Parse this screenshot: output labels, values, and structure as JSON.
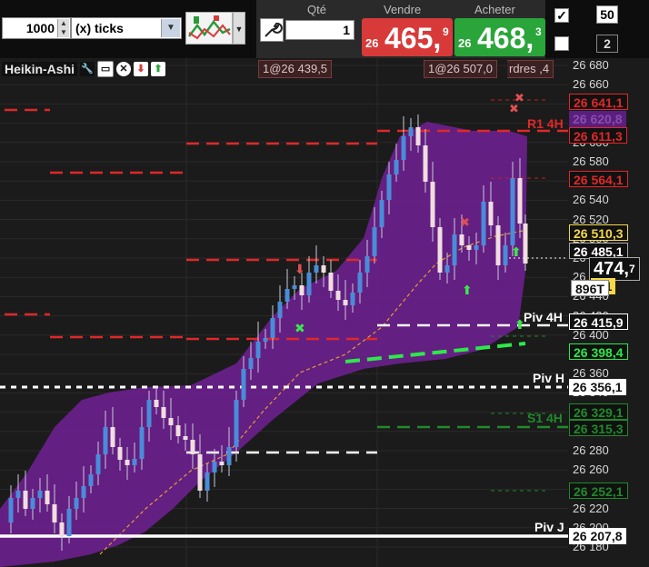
{
  "toolbar": {
    "tick_count": "1000",
    "tick_unit": "(x) ticks",
    "strategy_icon": "strategy-chart-icon"
  },
  "order": {
    "qty_label": "Qté",
    "qty_value": "1",
    "sell_label": "Vendre",
    "sell_prefix": "26",
    "sell_main": "465,",
    "sell_frac": "9",
    "buy_label": "Acheter",
    "buy_prefix": "26",
    "buy_main": "468,",
    "buy_frac": "3"
  },
  "options": {
    "check1": "✓",
    "num1": "50",
    "num2": "2"
  },
  "indicator": {
    "name": "Heikin-Ashi",
    "icons": [
      "wrench-icon",
      "window-icon",
      "close-icon",
      "down-arrow-icon",
      "up-arrow-icon"
    ]
  },
  "flags": {
    "left": "1@26 439,5",
    "right": "1@26 507,0",
    "right_suffix": "rdres ,4"
  },
  "axis_ticks": [
    "26 680",
    "26 660",
    "26 640",
    "26 620",
    "26 600",
    "26 580",
    "26 560",
    "26 540",
    "26 520",
    "26 500",
    "26 480",
    "26 460",
    "26 440",
    "26 420",
    "26 400",
    "26 380",
    "26 360",
    "26 340",
    "26 320",
    "26 300",
    "26 280",
    "26 260",
    "26 240",
    "26 220",
    "26 200",
    "26 180"
  ],
  "axis_labels": {
    "l1": "26 641,1",
    "l2": "26 620,8",
    "l3": "26 611,3",
    "l4": "26 564,1",
    "l5": "26 510,3",
    "l6": "26 485,1",
    "last_main": "474,",
    "last_frac": "7",
    "l7": "7,1",
    "ticks_badge": "896T",
    "l8": "26 415,9",
    "l9": "26 398,4",
    "l10": "26 356,1",
    "l11": "26 329,1",
    "l12": "26 315,3",
    "l13": "26 252,1",
    "l14": "26 207,8"
  },
  "levels": {
    "r1": "R1 4H",
    "piv4h": "Piv 4H",
    "pivh": "Piv H",
    "s14h": "S1 4H",
    "pivj": "Piv J"
  },
  "colors": {
    "background": "#1b1b1b",
    "envelope": "#6a1f8c",
    "bull": "#4a8cd8",
    "bear": "#f0dde0",
    "resistance": "#e02828",
    "support": "#1f8a2a",
    "pivot": "#ffffff"
  }
}
